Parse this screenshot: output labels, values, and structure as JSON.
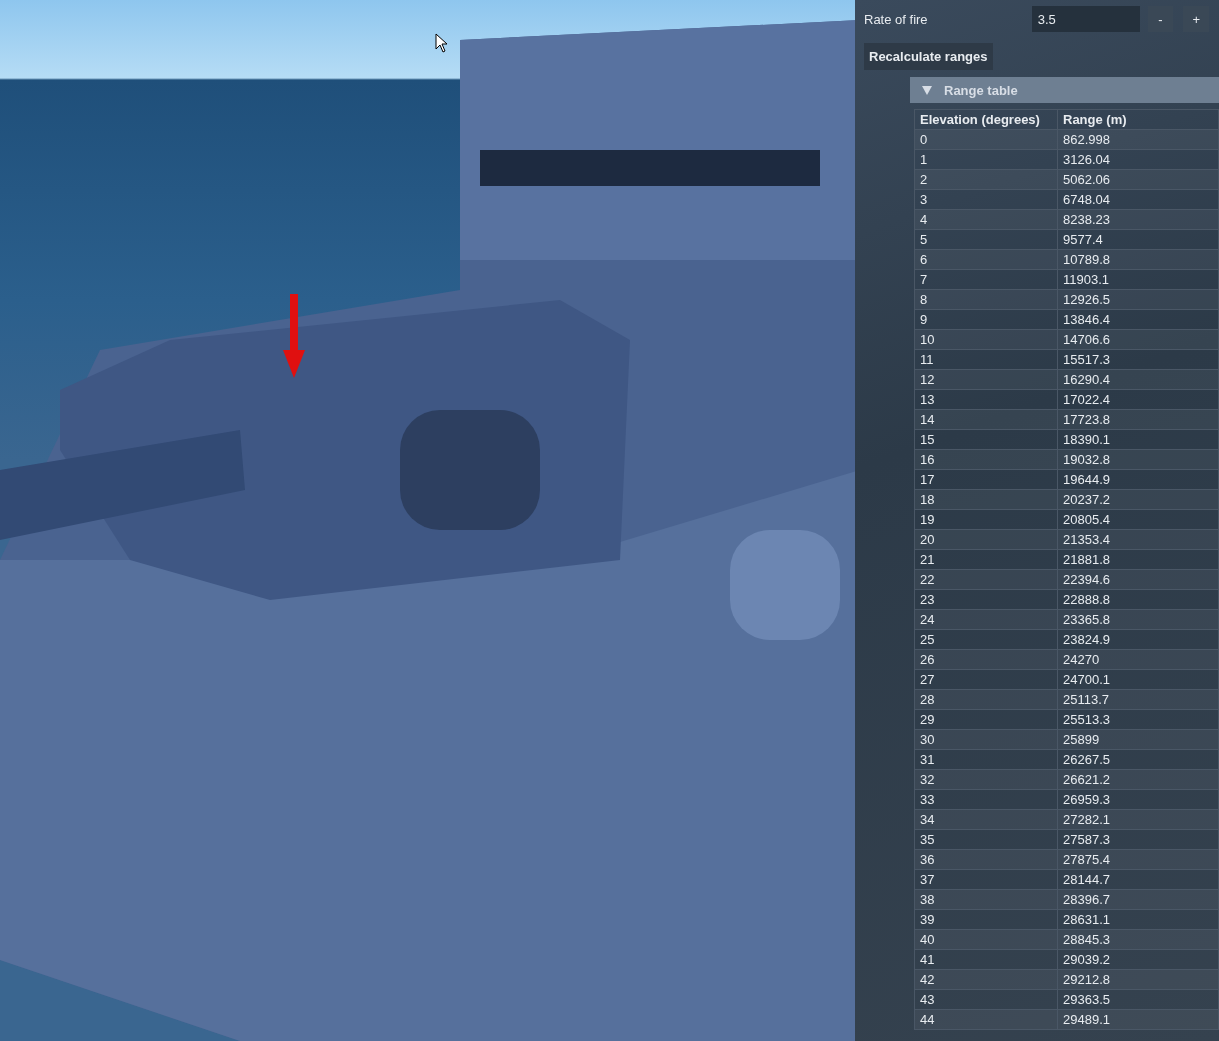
{
  "settings": {
    "rate_of_fire": {
      "label": "Rate of fire",
      "value": "3.5",
      "buttons": [
        "-",
        "+"
      ]
    },
    "recalculate_button": "Recalculate ranges"
  },
  "range_table": {
    "title": "Range table",
    "expanded": true,
    "columns": [
      "Elevation (degrees)",
      "Range (m)"
    ],
    "rows": [
      [
        "0",
        "862.998"
      ],
      [
        "1",
        "3126.04"
      ],
      [
        "2",
        "5062.06"
      ],
      [
        "3",
        "6748.04"
      ],
      [
        "4",
        "8238.23"
      ],
      [
        "5",
        "9577.4"
      ],
      [
        "6",
        "10789.8"
      ],
      [
        "7",
        "11903.1"
      ],
      [
        "8",
        "12926.5"
      ],
      [
        "9",
        "13846.4"
      ],
      [
        "10",
        "14706.6"
      ],
      [
        "11",
        "15517.3"
      ],
      [
        "12",
        "16290.4"
      ],
      [
        "13",
        "17022.4"
      ],
      [
        "14",
        "17723.8"
      ],
      [
        "15",
        "18390.1"
      ],
      [
        "16",
        "19032.8"
      ],
      [
        "17",
        "19644.9"
      ],
      [
        "18",
        "20237.2"
      ],
      [
        "19",
        "20805.4"
      ],
      [
        "20",
        "21353.4"
      ],
      [
        "21",
        "21881.8"
      ],
      [
        "22",
        "22394.6"
      ],
      [
        "23",
        "22888.8"
      ],
      [
        "24",
        "23365.8"
      ],
      [
        "25",
        "23824.9"
      ],
      [
        "26",
        "24270"
      ],
      [
        "27",
        "24700.1"
      ],
      [
        "28",
        "25113.7"
      ],
      [
        "29",
        "25513.3"
      ],
      [
        "30",
        "25899"
      ],
      [
        "31",
        "26267.5"
      ],
      [
        "32",
        "26621.2"
      ],
      [
        "33",
        "26959.3"
      ],
      [
        "34",
        "27282.1"
      ],
      [
        "35",
        "27587.3"
      ],
      [
        "36",
        "27875.4"
      ],
      [
        "37",
        "28144.7"
      ],
      [
        "38",
        "28396.7"
      ],
      [
        "39",
        "28631.1"
      ],
      [
        "40",
        "28845.3"
      ],
      [
        "41",
        "29039.2"
      ],
      [
        "42",
        "29212.8"
      ],
      [
        "43",
        "29363.5"
      ],
      [
        "44",
        "29489.1"
      ]
    ]
  }
}
